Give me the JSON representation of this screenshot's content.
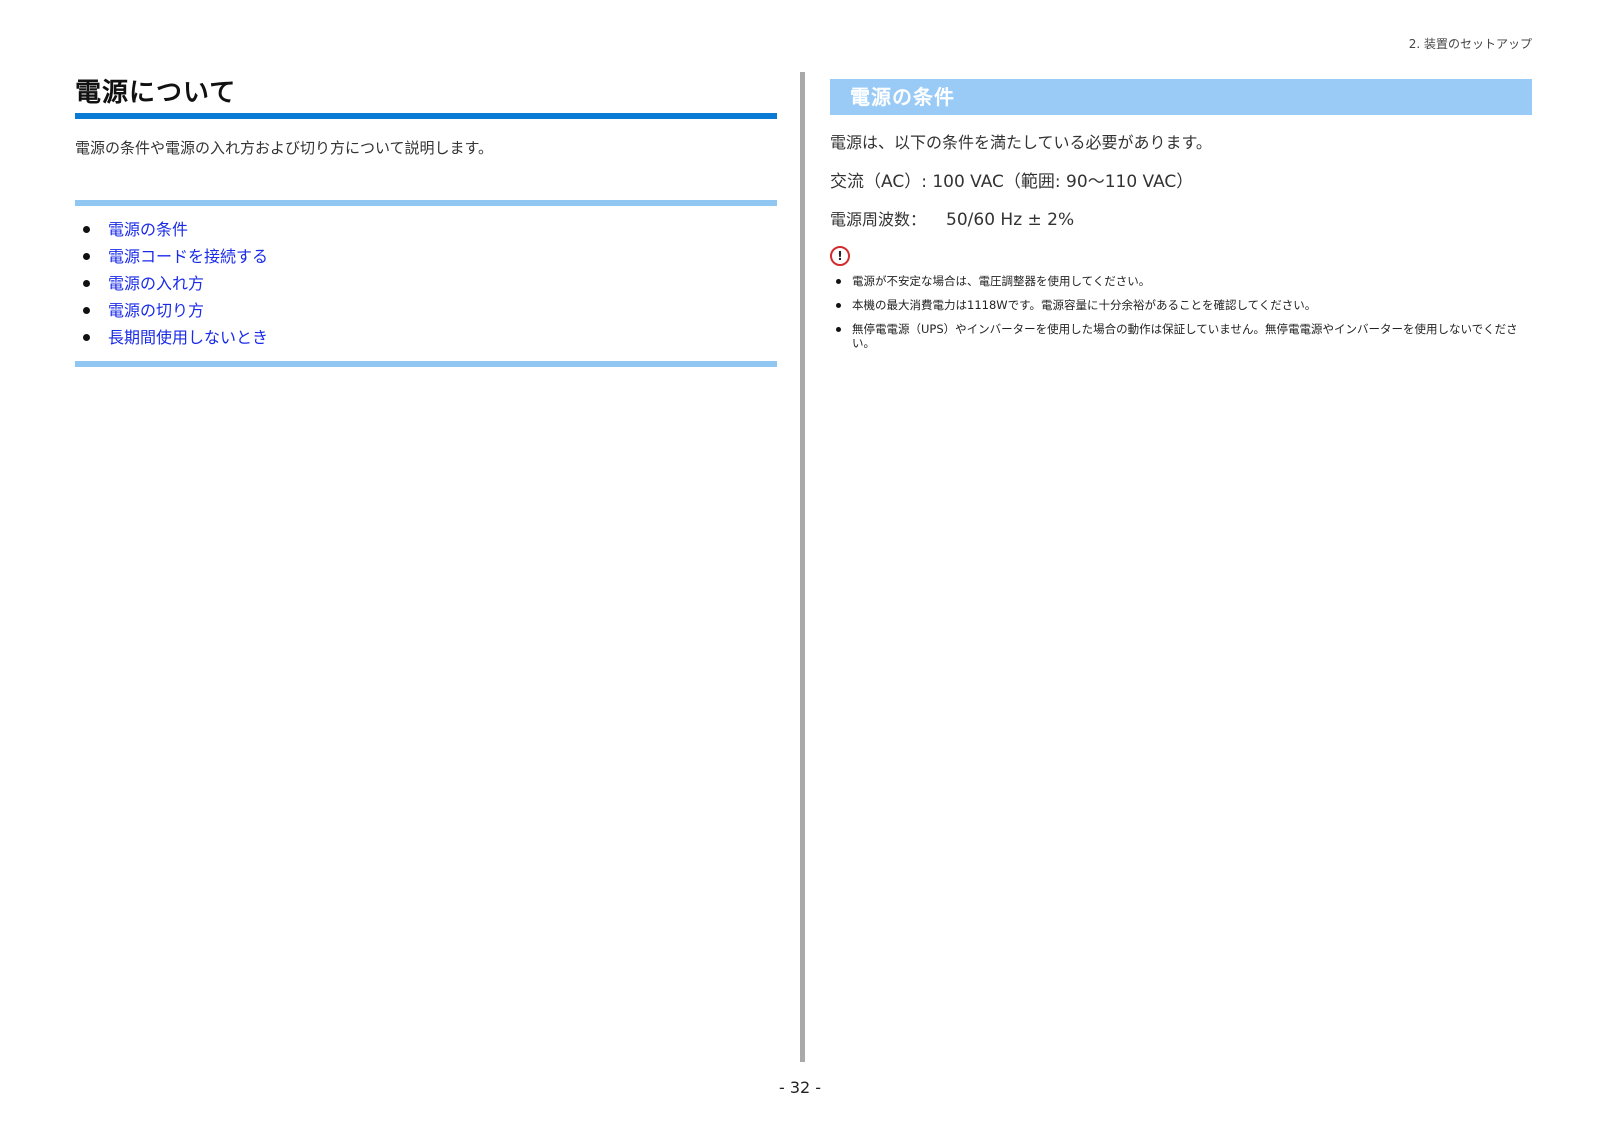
{
  "chapter_header": "2. 装置のセットアップ",
  "page_title": "電源について",
  "intro": "電源の条件や電源の入れ方および切り方について説明します。",
  "toc": [
    {
      "label": "電源の条件"
    },
    {
      "label": "電源コードを接続する"
    },
    {
      "label": "電源の入れ方"
    },
    {
      "label": "電源の切り方"
    },
    {
      "label": "長期間使用しないとき"
    }
  ],
  "section": {
    "title": "電源の条件",
    "lead": "電源は、以下の条件を満たしている必要があります。",
    "ac_spec": "交流（AC）: 100 VAC（範囲: 90～110 VAC）",
    "freq_label": "電源周波数：",
    "freq_value": "50/60 Hz ± 2%",
    "notice_glyph": "!",
    "notices": [
      "電源が不安定な場合は、電圧調整器を使用してください。",
      "本機の最大消費電力は1118Wです。電源容量に十分余裕があることを確認してください。",
      "無停電電源（UPS）やインバーターを使用した場合の動作は保証していません。無停電電源やインバーターを使用しないでください。"
    ]
  },
  "page_number": "- 32 -",
  "colors": {
    "title_rule": "#0a7bd4",
    "toc_border": "#8fc6f2",
    "section_header_bg": "#9acbf7",
    "link": "#1a2be8",
    "divider": "#a9a9a9",
    "notice_ring": "#d12e2e"
  },
  "icons": {
    "notice": "caution-icon"
  }
}
